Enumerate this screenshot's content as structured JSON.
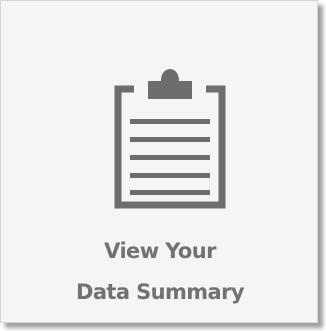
{
  "tile": {
    "label_line1": "View Your",
    "label_line2": "Data Summary",
    "icon": "clipboard-icon"
  },
  "colors": {
    "background": "#f5f5f5",
    "border": "#d6d6d6",
    "icon": "#6d6d6d",
    "text": "#727272"
  }
}
